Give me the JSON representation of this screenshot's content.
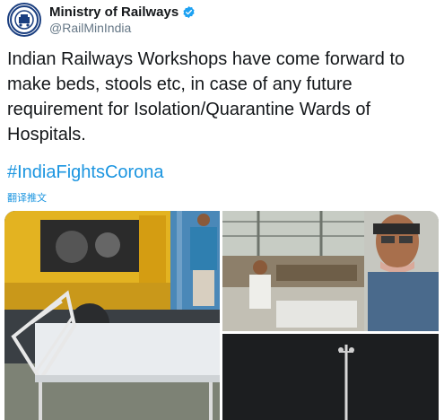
{
  "tweet": {
    "author": {
      "display_name": "Ministry of Railways",
      "handle": "@RailMinIndia",
      "verified": true,
      "avatar_icon": "indian-railways-logo-icon"
    },
    "text": "Indian Railways Workshops have come forward to make beds, stools etc, in case of any future requirement for Isolation/Quarantine Wards of Hospitals.",
    "hashtag": "#IndiaFightsCorona",
    "translate_label": "翻译推文",
    "media": [
      {
        "description_icon": "workshop-bed-photo"
      },
      {
        "description_icon": "workshop-floor-photo"
      },
      {
        "description_icon": "dark-pole-photo"
      }
    ]
  },
  "colors": {
    "link": "#1b95e0",
    "text": "#14171a",
    "secondary": "#657786",
    "verified": "#1da1f2"
  }
}
